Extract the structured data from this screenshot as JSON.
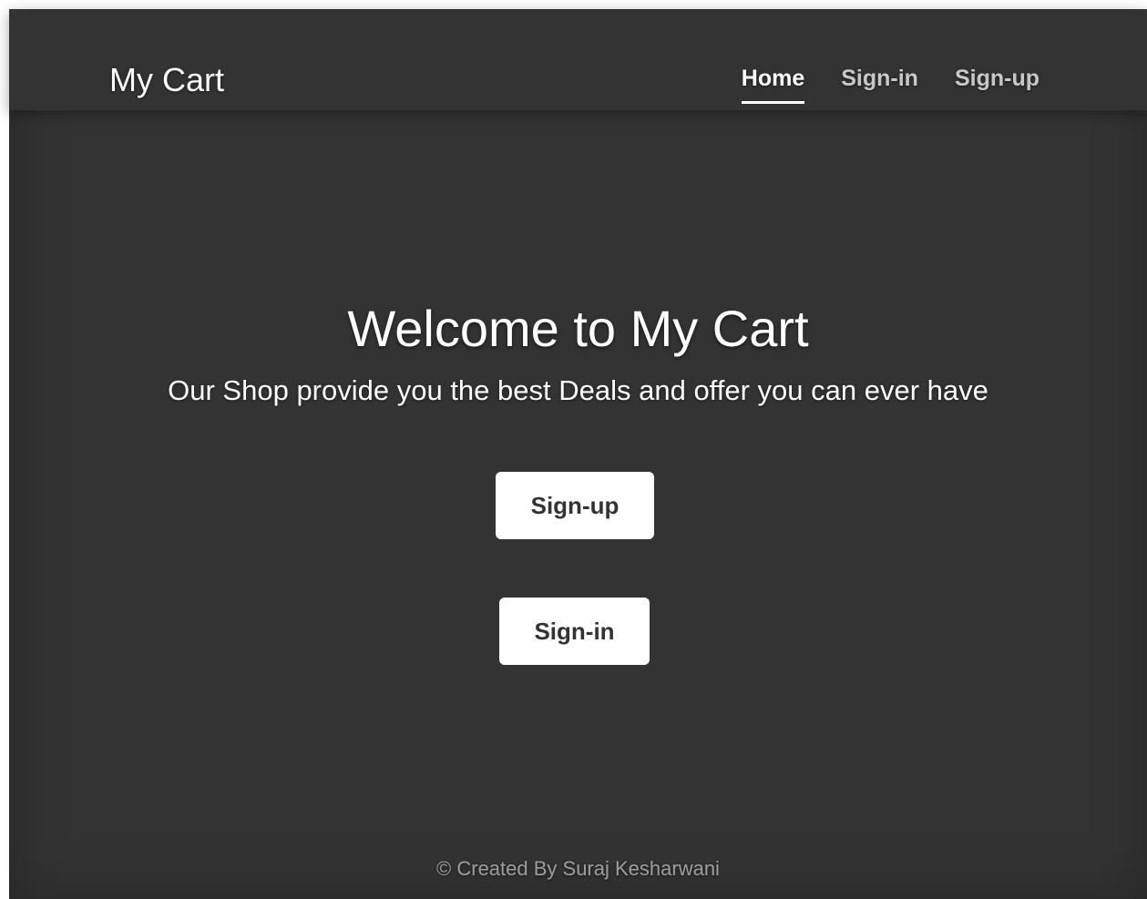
{
  "header": {
    "brand": "My Cart",
    "nav": [
      {
        "label": "Home",
        "active": true
      },
      {
        "label": "Sign-in",
        "active": false
      },
      {
        "label": "Sign-up",
        "active": false
      }
    ]
  },
  "main": {
    "heading": "Welcome to My Cart",
    "lead": "Our Shop provide you the best Deals and offer you can ever have",
    "signup_button": "Sign-up",
    "signin_button": "Sign-in"
  },
  "footer": {
    "text": "© Created By Suraj Kesharwani"
  },
  "colors": {
    "background": "#333333",
    "text": "#ffffff",
    "button_bg": "#ffffff",
    "button_text": "#333333"
  }
}
